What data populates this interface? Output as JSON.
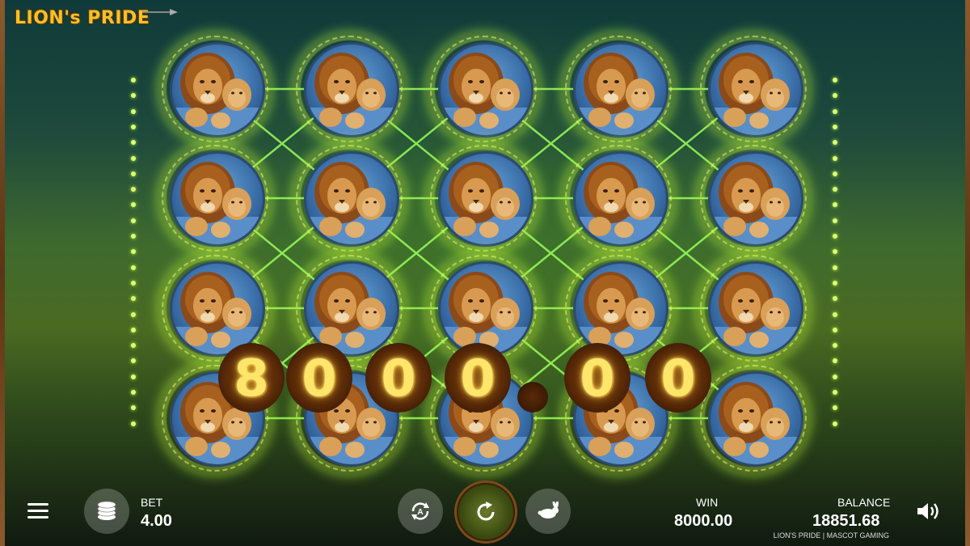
{
  "logo": {
    "text": "LION's PRIDE"
  },
  "grid": {
    "columns": 5,
    "rows": 4,
    "symbol": "lion-pride-symbol"
  },
  "win_overlay": {
    "digits": [
      "8",
      "0",
      "0",
      "0",
      ".",
      "0",
      "0"
    ]
  },
  "controls": {
    "bet_label": "BET",
    "bet_value": "4.00",
    "win_label": "WIN",
    "win_value": "8000.00",
    "balance_label": "BALANCE",
    "balance_value": "18851.68",
    "footer": "LION'S PRIDE | MASCOT GAMING"
  },
  "icons": {
    "menu": "hamburger-icon",
    "bet": "coin-stack-icon",
    "autoplay": "autoplay-icon",
    "spin": "spin-icon",
    "turbo": "rabbit-icon",
    "sound": "speaker-icon"
  },
  "colors": {
    "accent": "#f6c02a",
    "glow": "#c8ff3a",
    "line": "#9aff5a"
  }
}
